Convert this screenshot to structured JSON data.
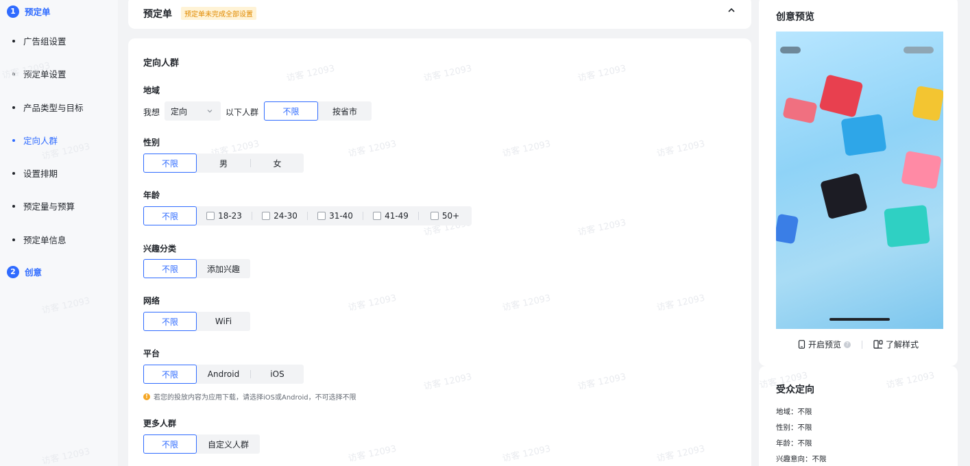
{
  "sidebar": {
    "steps": [
      {
        "num": "1",
        "label": "预定单"
      },
      {
        "num": "2",
        "label": "创意"
      }
    ],
    "items": [
      {
        "label": "广告组设置"
      },
      {
        "label": "预定单设置"
      },
      {
        "label": "产品类型与目标"
      },
      {
        "label": "定向人群"
      },
      {
        "label": "设置排期"
      },
      {
        "label": "预定量与预算"
      },
      {
        "label": "预定单信息"
      }
    ]
  },
  "header": {
    "title": "预定单",
    "badge": "预定单未完成全部设置"
  },
  "form": {
    "section_title": "定向人群",
    "region": {
      "label": "地域",
      "prefix": "我想",
      "select_value": "定向",
      "suffix": "以下人群",
      "options": [
        "不限",
        "按省市"
      ]
    },
    "gender": {
      "label": "性别",
      "options": [
        "不限",
        "男",
        "女"
      ]
    },
    "age": {
      "label": "年龄",
      "unlimited": "不限",
      "options": [
        "18-23",
        "24-30",
        "31-40",
        "41-49",
        "50+"
      ]
    },
    "interest": {
      "label": "兴趣分类",
      "options": [
        "不限",
        "添加兴趣"
      ]
    },
    "network": {
      "label": "网络",
      "options": [
        "不限",
        "WiFi"
      ]
    },
    "platform": {
      "label": "平台",
      "options": [
        "不限",
        "Android",
        "iOS"
      ],
      "hint": "若您的投放内容为应用下载，请选择iOS或Android，不可选择不限"
    },
    "more": {
      "label": "更多人群",
      "options": [
        "不限",
        "自定义人群"
      ]
    }
  },
  "preview": {
    "title": "创意预览",
    "open_preview": "开启预览",
    "learn_style": "了解样式"
  },
  "audience": {
    "title": "受众定向",
    "rows": [
      {
        "key": "地域：",
        "value": "不限"
      },
      {
        "key": "性别：",
        "value": "不限"
      },
      {
        "key": "年龄：",
        "value": "不限"
      },
      {
        "key": "兴趣意向：",
        "value": "不限"
      }
    ]
  },
  "watermark": "访客 12093",
  "colors": {
    "accent": "#2f6bff",
    "warning": "#e08a00",
    "page_bg": "#f2f3f5"
  }
}
